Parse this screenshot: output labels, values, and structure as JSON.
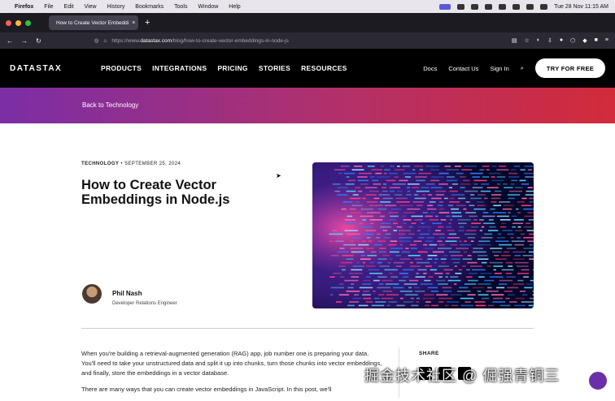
{
  "macos_menubar": {
    "app": "Firefox",
    "menus": [
      "File",
      "Edit",
      "View",
      "History",
      "Bookmarks",
      "Tools",
      "Window",
      "Help"
    ],
    "clock": "Tue 28 Nov  11:15 AM"
  },
  "browser": {
    "tab_title": "How to Create Vector Embeddi",
    "url_prefix": "https://www.",
    "url_domain": "datastax.com",
    "url_path": "/blog/how-to-create-vector-embeddings-in-node-js"
  },
  "site": {
    "logo": "DATASTAX",
    "nav": [
      "PRODUCTS",
      "INTEGRATIONS",
      "PRICING",
      "STORIES",
      "RESOURCES"
    ],
    "docs": "Docs",
    "contact": "Contact Us",
    "signin": "Sign In",
    "cta": "TRY FOR FREE"
  },
  "banner": {
    "back_link": "Back to Technology"
  },
  "post": {
    "category": "TECHNOLOGY",
    "date": "SEPTEMBER 25, 2024",
    "title": "How to Create Vector Embeddings in Node.js",
    "author_name": "Phil Nash",
    "author_role": "Developer Relations Engineer",
    "paragraph1": "When you're building a retrieval-augmented generation (RAG) app, job number one is preparing your data. You'll need to take your unstructured data and split it up into chunks, turn those chunks into vector embeddings, and finally, store the embeddings in a vector database.",
    "paragraph2": "There are many ways that you can create vector embeddings in JavaScript. In this post, we'll"
  },
  "share": {
    "label": "SHARE"
  },
  "watermark": "掘金技术社区 @ 倔强青铜三",
  "colors": {
    "banner_start": "#7b2ea6",
    "banner_end": "#d22b3a",
    "chat": "#6b2fa8"
  }
}
